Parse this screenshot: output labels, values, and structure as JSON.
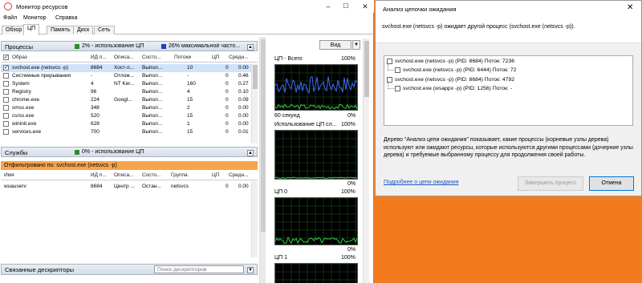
{
  "window": {
    "title": "Монитор ресурсов",
    "controls": {
      "minimize": "–",
      "maximize": "☐",
      "close": "✕"
    }
  },
  "menu": [
    "Файл",
    "Монитор",
    "Справка"
  ],
  "tabs": [
    "Обзор",
    "ЦП",
    "Память",
    "Диск",
    "Сеть"
  ],
  "active_tab": "ЦП",
  "processes_panel": {
    "title": "Процессы",
    "usage_text": "2% - использование ЦП",
    "max_freq_text": "26% максимальной часто...",
    "usage_color": "#2e8b2e",
    "freq_color": "#1e3fbf",
    "columns": [
      "Образ",
      "ИД п...",
      "Описа...",
      "Состо...",
      "Потоки",
      "ЦП",
      "Средн..."
    ],
    "rows": [
      {
        "checked": true,
        "name": "svchost.exe (netsvcs -p)",
        "pid": "8684",
        "desc": "Хост-п...",
        "state": "Выпол...",
        "threads": "10",
        "cpu": "0",
        "avg": "0.00"
      },
      {
        "checked": false,
        "name": "Системные прерывания",
        "pid": "-",
        "desc": "Отлож...",
        "state": "Выпол...",
        "threads": "-",
        "cpu": "0",
        "avg": "0.46"
      },
      {
        "checked": false,
        "name": "System",
        "pid": "4",
        "desc": "NT Ker...",
        "state": "Выпол...",
        "threads": "160",
        "cpu": "0",
        "avg": "0.27"
      },
      {
        "checked": false,
        "name": "Registry",
        "pid": "96",
        "desc": "",
        "state": "Выпол...",
        "threads": "4",
        "cpu": "0",
        "avg": "0.10"
      },
      {
        "checked": false,
        "name": "chrome.exe",
        "pid": "224",
        "desc": "Googl...",
        "state": "Выпол...",
        "threads": "15",
        "cpu": "0",
        "avg": "0.09"
      },
      {
        "checked": false,
        "name": "smss.exe",
        "pid": "348",
        "desc": "",
        "state": "Выпол...",
        "threads": "2",
        "cpu": "0",
        "avg": "0.00"
      },
      {
        "checked": false,
        "name": "csrss.exe",
        "pid": "520",
        "desc": "",
        "state": "Выпол...",
        "threads": "15",
        "cpu": "0",
        "avg": "0.00"
      },
      {
        "checked": false,
        "name": "wininit.exe",
        "pid": "628",
        "desc": "",
        "state": "Выпол...",
        "threads": "1",
        "cpu": "0",
        "avg": "0.00"
      },
      {
        "checked": false,
        "name": "services.exe",
        "pid": "700",
        "desc": "",
        "state": "Выпол...",
        "threads": "15",
        "cpu": "0",
        "avg": "0.01"
      }
    ]
  },
  "services_panel": {
    "title": "Службы",
    "usage_text": "0% - использование ЦП",
    "usage_color": "#2e8b2e",
    "filter_text": "Отфильтровано по: svchost.exe (netsvcs -p)",
    "columns": [
      "Имя",
      "ИД п...",
      "Описа...",
      "Состо...",
      "Группа",
      "ЦП",
      "Средн..."
    ],
    "rows": [
      {
        "name": "wuauserv",
        "pid": "8684",
        "desc": "Центр ...",
        "state": "Остан...",
        "group": "netsvcs",
        "cpu": "0",
        "avg": "0.00"
      }
    ]
  },
  "handles_panel": {
    "title": "Связанные дескрипторы",
    "search_placeholder": "Поиск дескрипторов"
  },
  "graphs": {
    "view_button": "Вид",
    "cpu_total": {
      "label": "ЦП - Всего",
      "max": "100%",
      "min": "0%",
      "time": "60 секунд"
    },
    "service_cpu": {
      "label": "Использование ЦП сл...",
      "max": "100%",
      "min": "0%"
    },
    "cpu0": {
      "label": "ЦП 0",
      "max": "100%",
      "min": "0%"
    },
    "cpu1": {
      "label": "ЦП 1",
      "max": "100%"
    },
    "colors": {
      "usage": "#2ecc40",
      "freq": "#3a6cff",
      "grid": "#1f5a1f"
    }
  },
  "wait_chain": {
    "title": "Анализ цепочки ожидания",
    "close": "✕",
    "summary": "svchost.exe (netsvcs -p) ожидает другой процесс (svchost.exe (netsvcs -p)).",
    "tree": [
      {
        "level": 0,
        "text": "svchost.exe (netsvcs -p) (PID: 8684) Поток: 7236"
      },
      {
        "level": 1,
        "text": "svchost.exe (netsvcs -p) (PID: 6444) Поток: 72"
      },
      {
        "level": 0,
        "text": "svchost.exe (netsvcs -p) (PID: 8684) Поток: 4792"
      },
      {
        "level": 1,
        "text": "svchost.exe (wsappx -p) (PID: 1256) Поток: -"
      }
    ],
    "description": "Дерево \"Анализ цепи ожидания\" показывает, какие процессы (корневые узлы дерева) используют или ожидают ресурсы, которые используются другими процессами (дочерние узлы дерева) и требуемые выбранному процессу для продолжения своей работы.",
    "link": "Подробнее о цепи ожидания",
    "end_process_button": "Завершить процесс",
    "cancel_button": "Отмена"
  }
}
